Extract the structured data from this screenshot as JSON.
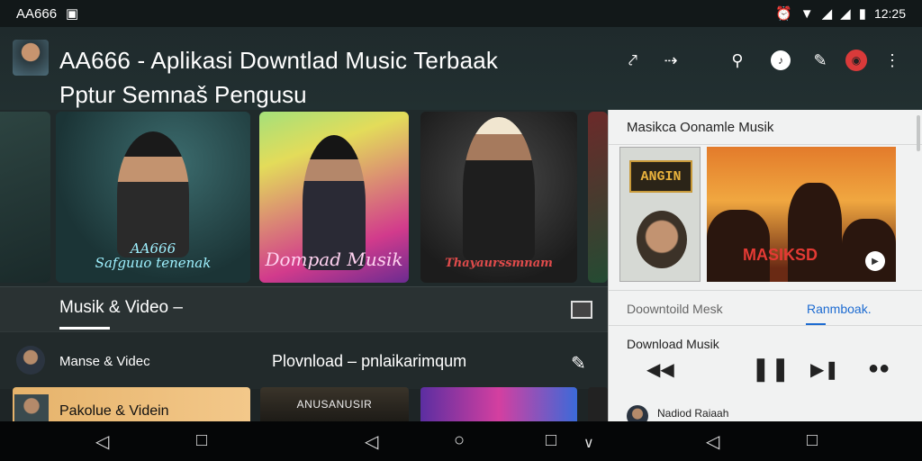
{
  "status": {
    "carrier": "AA666",
    "image_icon": "image-icon",
    "time": "12:25",
    "icons": [
      "alarm-icon",
      "wifi-icon",
      "signal-icon",
      "signal-icon",
      "battery-icon"
    ]
  },
  "header": {
    "title_line1": "AA666 - Aplikasi  Downtlad Music Terbaak",
    "title_line2": "Pptur Semnaš Pengusu",
    "actions": [
      "share-icon",
      "forward-icon",
      "search-icon",
      "music-icon",
      "mic-icon",
      "record-icon",
      "more-icon"
    ]
  },
  "carousel": {
    "cards": [
      {
        "caption": ""
      },
      {
        "caption": "AA666\nSafguuo tenenak"
      },
      {
        "caption": "Dompad Musik"
      },
      {
        "caption": "Thayaurssmnam"
      },
      {
        "caption": ""
      }
    ]
  },
  "section": {
    "label": "Musik & Video  –"
  },
  "row2": {
    "left_label": "Manse & Videc",
    "center_label": "Plovnload  –  pnlaikarimqum"
  },
  "bottom_cards": {
    "card1": "Pakolue & Videin",
    "card2": "ANUSANUSIR"
  },
  "panel": {
    "title": "Masikca Oonamle Musik",
    "image1_text": "ANGIN",
    "image2_text": "MASIKSD",
    "tab1": "Doowntoild Mesk",
    "tab2": "Ranmboak.",
    "now_playing_label": "Download Musik",
    "item_label": "Nadiod Raiaah"
  },
  "colors": {
    "accent_blue": "#1d6bd1",
    "record_red": "#d93a3a",
    "background": "#1e2526"
  }
}
